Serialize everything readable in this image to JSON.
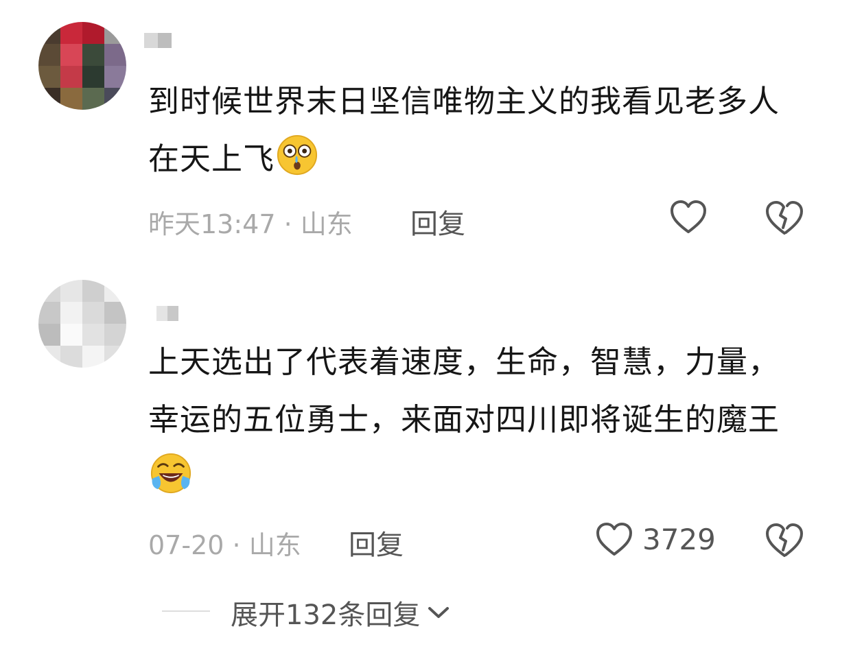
{
  "comments": [
    {
      "text": "到时候世界末日坚信唯物主义的我看见老多人在天上飞",
      "emoji": "shocked-crying-face-emoji",
      "time": "昨天13:47",
      "separator": "·",
      "location": "山东",
      "reply_label": "回复",
      "like_count": ""
    },
    {
      "text": "上天选出了代表着速度，生命，智慧，力量，幸运的五位勇士，来面对四川即将诞生的魔王",
      "emoji": "laughing-tears-face-emoji",
      "time": "07-20",
      "separator": "·",
      "location": "山东",
      "reply_label": "回复",
      "like_count": "3729"
    }
  ],
  "expand_replies": {
    "label": "展开132条回复",
    "icon": "chevron-down-icon"
  },
  "colors": {
    "meta_gray": "#a9a9a9",
    "action_gray": "#555555",
    "text": "#161616",
    "emoji_yellow": "#f7c531"
  }
}
